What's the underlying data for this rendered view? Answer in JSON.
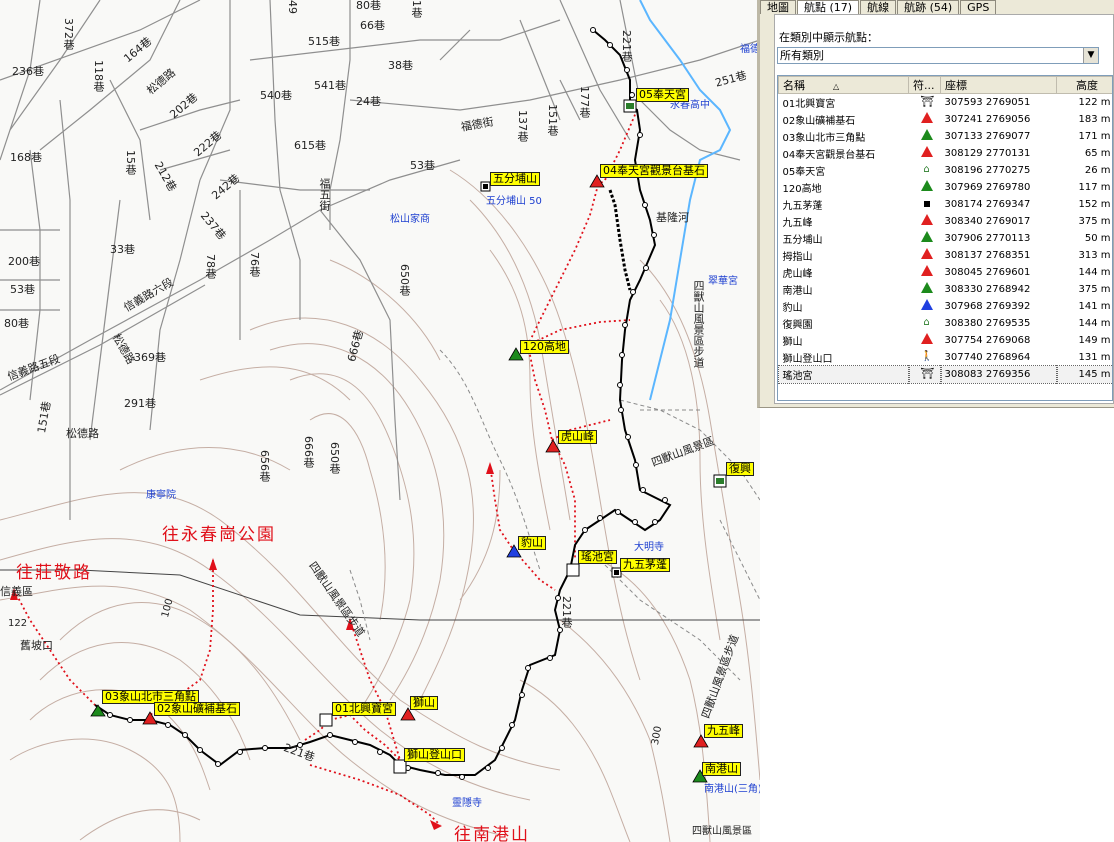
{
  "panel": {
    "tabs": [
      {
        "label": "地圖",
        "active": false
      },
      {
        "label": "航點 (17)",
        "active": true
      },
      {
        "label": "航線",
        "active": false
      },
      {
        "label": "航跡 (54)",
        "active": false
      },
      {
        "label": "GPS",
        "active": false
      }
    ],
    "filter_label": "在類別中顯示航點：",
    "category_value": "所有類別",
    "columns": {
      "name": "名稱",
      "symbol": "符...",
      "coord": "座標",
      "alt": "高度"
    },
    "waypoints": [
      {
        "name": "01北興寶宮",
        "symbol": "temple",
        "coord": "307593 2769051",
        "alt": "122 m"
      },
      {
        "name": "02象山礦補基石",
        "symbol": "peak-red",
        "coord": "307241 2769056",
        "alt": "183 m"
      },
      {
        "name": "03象山北市三角點",
        "symbol": "peak-green",
        "coord": "307133 2769077",
        "alt": "171 m"
      },
      {
        "name": "04奉天宮觀景台基石",
        "symbol": "peak-red",
        "coord": "308129 2770131",
        "alt": "65 m"
      },
      {
        "name": "05奉天宮",
        "symbol": "building",
        "coord": "308196 2770275",
        "alt": "26 m"
      },
      {
        "name": "120高地",
        "symbol": "peak-green",
        "coord": "307969 2769780",
        "alt": "117 m"
      },
      {
        "name": "九五茅蓬",
        "symbol": "dot",
        "coord": "308174 2769347",
        "alt": "152 m"
      },
      {
        "name": "九五峰",
        "symbol": "peak-red",
        "coord": "308340 2769017",
        "alt": "375 m"
      },
      {
        "name": "五分埔山",
        "symbol": "peak-green",
        "coord": "307906 2770113",
        "alt": "50 m"
      },
      {
        "name": "拇指山",
        "symbol": "peak-red",
        "coord": "308137 2768351",
        "alt": "313 m"
      },
      {
        "name": "虎山峰",
        "symbol": "peak-red",
        "coord": "308045 2769601",
        "alt": "144 m"
      },
      {
        "name": "南港山",
        "symbol": "peak-green",
        "coord": "308330 2768942",
        "alt": "375 m"
      },
      {
        "name": "豹山",
        "symbol": "peak-blue",
        "coord": "307968 2769392",
        "alt": "141 m"
      },
      {
        "name": "復興園",
        "symbol": "building",
        "coord": "308380 2769535",
        "alt": "144 m"
      },
      {
        "name": "獅山",
        "symbol": "peak-red",
        "coord": "307754 2769068",
        "alt": "149 m"
      },
      {
        "name": "獅山登山口",
        "symbol": "hiker",
        "coord": "307740 2768964",
        "alt": "131 m"
      },
      {
        "name": "瑤池宮",
        "symbol": "temple",
        "coord": "308083 2769356",
        "alt": "145 m",
        "selected": true
      }
    ]
  },
  "map": {
    "street_labels": {
      "l372": "372巷",
      "l164": "164巷",
      "l118": "118巷",
      "l236": "236巷",
      "songde": "松德路",
      "l202": "202巷",
      "l212": "212巷",
      "l222": "222巷",
      "l242": "242巷",
      "l237": "237巷",
      "l515": "515巷",
      "l541": "541巷",
      "l540": "540巷",
      "l66": "66巷",
      "l38": "38巷",
      "l24": "24巷",
      "l615": "615巷",
      "l53": "53巷",
      "l15": "15巷",
      "l168": "168巷",
      "l200": "200巷",
      "l53b": "53巷",
      "l80": "80巷",
      "l33": "33巷",
      "l78": "78巷",
      "l76": "76巷",
      "l650": "650巷",
      "l666": "666巷",
      "l369": "369巷",
      "l291": "291巷",
      "l151": "151巷",
      "xinyi6": "信義路六段",
      "xinyi5": "信義路五段",
      "songde2": "松德路",
      "songde3": "松德路",
      "l656": "656巷",
      "l666b": "666巷",
      "l650b": "650巷",
      "l137": "137巷",
      "l151b": "151巷",
      "l177": "177巷",
      "l251": "251巷",
      "l221": "221巷",
      "l221b": "221巷",
      "l221c": "221巷",
      "fude": "福德街",
      "fuwu": "福五街",
      "jilong": "基隆河",
      "xinyi": "信義區",
      "l122": "122",
      "jiupo": "舊坡口",
      "ridge1": "四獸山風景區",
      "ridge2": "四獸山風景區步道",
      "ridge3": "四獸山風景區步道",
      "ridge4": "四獸山風景區步道",
      "ridge5": "四獸山風景區",
      "c100": "100",
      "c300": "300",
      "l49": "49",
      "l80b": "80巷",
      "l1b": "1巷"
    },
    "blue_labels": {
      "school": "永春高中",
      "wufen": "五分埔山 50",
      "songshan": "松山家商",
      "zhenghua": "翠華宮",
      "damingsi": "大明寺",
      "ligongsi": "靈隱寺",
      "hospital": "康寧院",
      "nangang2": "南港山(三角)",
      "fuxing": "福德宮"
    },
    "red_labels": {
      "zhuangjing": "往莊敬路",
      "yongchun": "往永春崗公園",
      "nangang": "往南港山"
    },
    "waypoint_labels": {
      "w05": "05奉天宮",
      "w04": "04奉天宮觀景台基石",
      "wufen": "五分埔山",
      "w120": "120高地",
      "hushan": "虎山峰",
      "fuxing": "復興",
      "baoshan": "豹山",
      "yaochi": "瑤池宮",
      "jiuwumao": "九五茅蓬",
      "w03": "03象山北市三角點",
      "w02": "02象山礦補基石",
      "w01": "01北興寶宮",
      "shishan": "獅山",
      "shishan_trail": "獅山登山口",
      "jiuwufeng": "九五峰",
      "nangangshan": "南港山"
    }
  },
  "colors": {
    "track_black": "#000000",
    "route_red": "#e0101a",
    "river": "#5bb6ff",
    "road": "#9a9a9a",
    "contour": "#b89e94",
    "label_yellow": "#ffff00"
  }
}
